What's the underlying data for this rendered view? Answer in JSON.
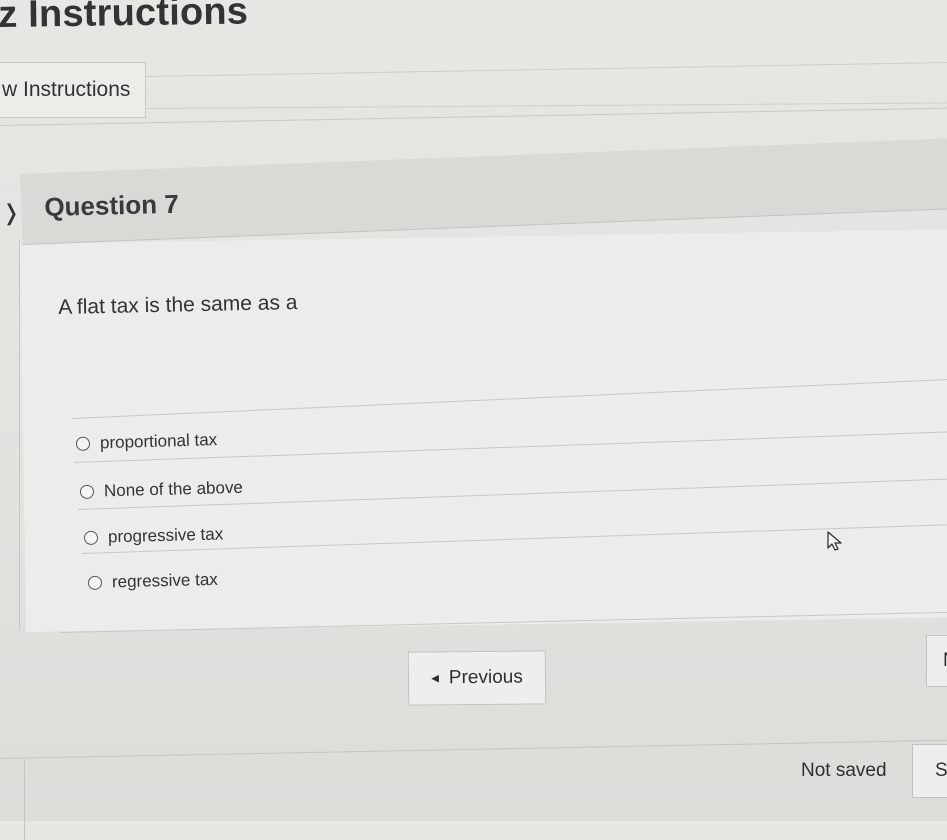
{
  "page": {
    "title": "z Instructions"
  },
  "instructions_tab": {
    "label": "w Instructions"
  },
  "question": {
    "label": "Question 7",
    "text": "A flat tax is the same as a",
    "options": [
      {
        "label": "proportional tax"
      },
      {
        "label": "None of the above"
      },
      {
        "label": "progressive tax"
      },
      {
        "label": "regressive tax"
      }
    ]
  },
  "navigation": {
    "previous_label": "Previous",
    "next_label": "N"
  },
  "footer": {
    "status": "Not saved",
    "save_label": "S"
  },
  "icons": {
    "collapse": "chevron-right-icon",
    "previous": "caret-left-icon",
    "cursor": "mouse-pointer-icon"
  }
}
